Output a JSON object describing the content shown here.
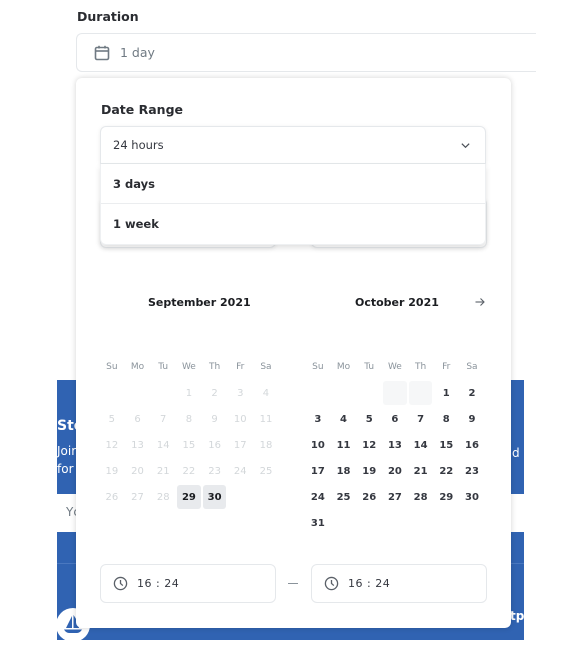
{
  "duration": {
    "label": "Duration",
    "value": "1 day",
    "icon": "calendar-icon"
  },
  "background": {
    "title_fragment": "Sto",
    "join_fragment": "Joir",
    "for_fragment": "for",
    "right_fragment": "d",
    "input_fragment": "Yc",
    "footer_fragment": "tp",
    "colors": {
      "brand_blue": "#3063b2"
    }
  },
  "date_range": {
    "label": "Date Range",
    "selected": "24 hours",
    "options": [
      "3 days",
      "1 week"
    ]
  },
  "calendar": {
    "weekdays": [
      "Su",
      "Mo",
      "Tu",
      "We",
      "Th",
      "Fr",
      "Sa"
    ],
    "months": [
      {
        "title": "September 2021",
        "leading_blanks": 3,
        "days": [
          {
            "d": "1",
            "s": "disabled"
          },
          {
            "d": "2",
            "s": "disabled"
          },
          {
            "d": "3",
            "s": "disabled"
          },
          {
            "d": "4",
            "s": "disabled"
          },
          {
            "d": "5",
            "s": "disabled"
          },
          {
            "d": "6",
            "s": "disabled"
          },
          {
            "d": "7",
            "s": "disabled"
          },
          {
            "d": "8",
            "s": "disabled"
          },
          {
            "d": "9",
            "s": "disabled"
          },
          {
            "d": "10",
            "s": "disabled"
          },
          {
            "d": "11",
            "s": "disabled"
          },
          {
            "d": "12",
            "s": "disabled"
          },
          {
            "d": "13",
            "s": "disabled"
          },
          {
            "d": "14",
            "s": "disabled"
          },
          {
            "d": "15",
            "s": "disabled"
          },
          {
            "d": "16",
            "s": "disabled"
          },
          {
            "d": "17",
            "s": "disabled"
          },
          {
            "d": "18",
            "s": "disabled"
          },
          {
            "d": "19",
            "s": "disabled"
          },
          {
            "d": "20",
            "s": "disabled"
          },
          {
            "d": "21",
            "s": "disabled"
          },
          {
            "d": "22",
            "s": "disabled"
          },
          {
            "d": "23",
            "s": "disabled"
          },
          {
            "d": "24",
            "s": "disabled"
          },
          {
            "d": "25",
            "s": "disabled"
          },
          {
            "d": "26",
            "s": "disabled"
          },
          {
            "d": "27",
            "s": "disabled"
          },
          {
            "d": "28",
            "s": "disabled"
          },
          {
            "d": "29",
            "s": "sel"
          },
          {
            "d": "30",
            "s": "sel"
          }
        ]
      },
      {
        "title": "October 2021",
        "leading_blanks": 5,
        "shaded_blanks": [
          3,
          4
        ],
        "days": [
          {
            "d": "1",
            "s": "active"
          },
          {
            "d": "2",
            "s": "active"
          },
          {
            "d": "3",
            "s": "active"
          },
          {
            "d": "4",
            "s": "active"
          },
          {
            "d": "5",
            "s": "active"
          },
          {
            "d": "6",
            "s": "active"
          },
          {
            "d": "7",
            "s": "active"
          },
          {
            "d": "8",
            "s": "active"
          },
          {
            "d": "9",
            "s": "active"
          },
          {
            "d": "10",
            "s": "active"
          },
          {
            "d": "11",
            "s": "active"
          },
          {
            "d": "12",
            "s": "active"
          },
          {
            "d": "13",
            "s": "active"
          },
          {
            "d": "14",
            "s": "active"
          },
          {
            "d": "15",
            "s": "active"
          },
          {
            "d": "16",
            "s": "active"
          },
          {
            "d": "17",
            "s": "active"
          },
          {
            "d": "18",
            "s": "active"
          },
          {
            "d": "19",
            "s": "active"
          },
          {
            "d": "20",
            "s": "active"
          },
          {
            "d": "21",
            "s": "active"
          },
          {
            "d": "22",
            "s": "active"
          },
          {
            "d": "23",
            "s": "active"
          },
          {
            "d": "24",
            "s": "active"
          },
          {
            "d": "25",
            "s": "active"
          },
          {
            "d": "26",
            "s": "active"
          },
          {
            "d": "27",
            "s": "active"
          },
          {
            "d": "28",
            "s": "active"
          },
          {
            "d": "29",
            "s": "active"
          },
          {
            "d": "30",
            "s": "active"
          },
          {
            "d": "31",
            "s": "active"
          }
        ]
      }
    ],
    "next_icon": "arrow-right-icon"
  },
  "time": {
    "start": "16 : 24",
    "end": "16 : 24",
    "icon": "clock-icon"
  }
}
